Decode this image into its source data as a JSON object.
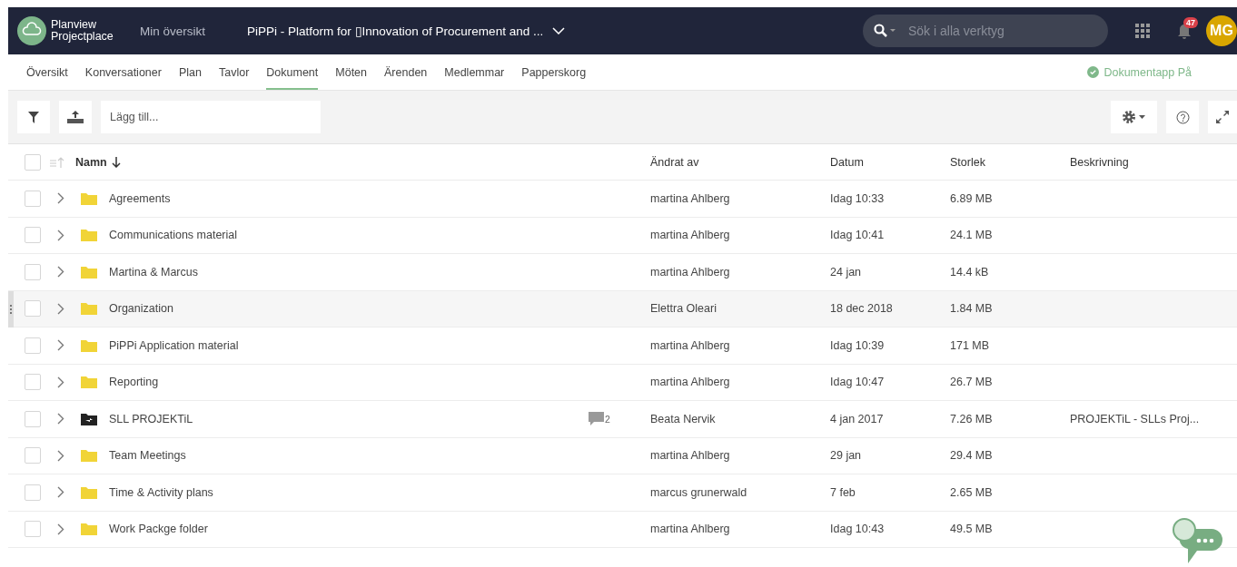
{
  "header": {
    "logo_line_1": "Planview",
    "logo_line_2": "Projectplace",
    "my_overview": "Min översikt",
    "project_title": "PiPPi -  Platform for ▯Innovation of Procurement and ...",
    "search": {
      "placeholder": "Sök i alla verktyg"
    },
    "notification_count": "47",
    "avatar": "MG"
  },
  "tabs": [
    {
      "label": "Översikt",
      "selected": false
    },
    {
      "label": "Konversationer",
      "selected": false
    },
    {
      "label": "Plan",
      "selected": false
    },
    {
      "label": "Tavlor",
      "selected": false
    },
    {
      "label": "Dokument",
      "selected": true
    },
    {
      "label": "Möten",
      "selected": false
    },
    {
      "label": "Ärenden",
      "selected": false
    },
    {
      "label": "Medlemmar",
      "selected": false
    },
    {
      "label": "Papperskorg",
      "selected": false
    }
  ],
  "doc_app_status": {
    "label": "Dokumentapp På",
    "on": true
  },
  "toolbar": {
    "add_placeholder": "Lägg till..."
  },
  "table": {
    "select_all_checked": false,
    "columns": [
      "Namn",
      "Ändrat av",
      "Datum",
      "Storlek",
      "Beskrivning"
    ],
    "rows": [
      {
        "kind": "folder",
        "name": "Agreements",
        "author": "martina Ahlberg",
        "date": "Idag 10:33",
        "size": "6.89 MB",
        "checked": false,
        "highlighted": false
      },
      {
        "kind": "folder",
        "name": "Communications material",
        "author": "martina Ahlberg",
        "date": "Idag 10:41",
        "size": "24.1 MB",
        "checked": false,
        "highlighted": false
      },
      {
        "kind": "folder",
        "name": "Martina & Marcus",
        "author": "martina Ahlberg",
        "date": "24 jan",
        "size": "14.4 kB",
        "checked": false,
        "highlighted": false
      },
      {
        "kind": "folder",
        "name": "Organization",
        "author": "Elettra Oleari",
        "date": "18 dec 2018",
        "size": "1.84 MB",
        "checked": false,
        "highlighted": true
      },
      {
        "kind": "folder",
        "name": "PiPPi Application material",
        "author": "martina Ahlberg",
        "date": "Idag 10:39",
        "size": "171 MB",
        "checked": false,
        "highlighted": false
      },
      {
        "kind": "folder",
        "name": "Reporting",
        "author": "martina Ahlberg",
        "date": "Idag 10:47",
        "size": "26.7 MB",
        "checked": false,
        "highlighted": false
      },
      {
        "kind": "shared",
        "name": "SLL PROJEKTiL",
        "comments": "2",
        "author": "Beata Nervik",
        "date": "4 jan 2017",
        "size": "7.26 MB",
        "description": "PROJEKTiL - SLLs Proj...",
        "checked": false,
        "highlighted": false
      },
      {
        "kind": "folder",
        "name": "Team Meetings",
        "author": "martina Ahlberg",
        "date": "29 jan",
        "size": "29.4 MB",
        "checked": false,
        "highlighted": false
      },
      {
        "kind": "folder",
        "name": "Time & Activity plans",
        "author": "marcus grunerwald",
        "date": "7 feb",
        "size": "2.65 MB",
        "checked": false,
        "highlighted": false
      },
      {
        "kind": "folder",
        "name": "Work Packge folder",
        "author": "martina Ahlberg",
        "date": "Idag 10:43",
        "size": "49.5 MB",
        "checked": false,
        "highlighted": false
      }
    ]
  }
}
